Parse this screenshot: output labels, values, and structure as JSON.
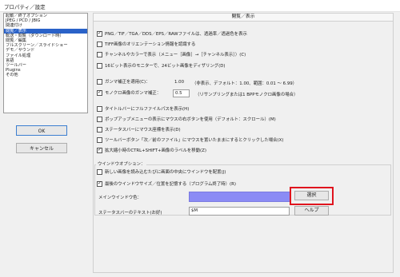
{
  "window": {
    "title": "プロパティ／設定"
  },
  "sidebar": {
    "items": [
      {
        "label": "起動／終了オプション"
      },
      {
        "label": "JPEG / PCD / JBIG"
      },
      {
        "label": "関連付け"
      },
      {
        "label": "閲覧／表示"
      },
      {
        "label": "転送・閲覧（ダウンロード時）"
      },
      {
        "label": "閲覧／編集"
      },
      {
        "label": "フルスクリーン／スライドショー"
      },
      {
        "label": "デモ／サウンド"
      },
      {
        "label": "ファイル処理"
      },
      {
        "label": "言語"
      },
      {
        "label": "ツールバー"
      },
      {
        "label": "Plugins"
      },
      {
        "label": "その他"
      }
    ],
    "selected_index": 3
  },
  "buttons": {
    "ok": "OK",
    "cancel": "キャンセル",
    "select": "選択",
    "help": "ヘルプ"
  },
  "panel": {
    "title": "閲覧／表示",
    "options": [
      {
        "label": "PNG／TIF／TGA／DDS／EPS／RAWファイルは、透過率／透過色を表示",
        "checked": true
      },
      {
        "label": "TIFF画像のオリエンテーション情報を認識する",
        "checked": false
      },
      {
        "label": "チャンネルやカラーで表示（メニュー［画像］→［チャンネル表示］）(C)",
        "checked": false
      },
      {
        "label": "16ビット表示のモニターで、24ビット画像をディザリング(D)",
        "checked": false
      }
    ],
    "gamma": {
      "label": "ガンマ補正を適用(C)：",
      "value": "1.00",
      "note": "（非表示、デフォルト：1.00、範囲：0.01 ～ 6.99）"
    },
    "mono_gamma": {
      "label": "モノクロ画像のガンマ補正：",
      "value": "0.5",
      "note": "（リサンプリングまたは1 BPPモノクロ画像の場合）"
    },
    "options2": [
      {
        "label": "タイトルバーにフルファイルパスを表示(H)",
        "checked": false
      },
      {
        "label": "ポップアップメニューの表示にマウスの右ボタンを使用（デフォルト：スクロール）(M)",
        "checked": false
      },
      {
        "label": "ステータスバーにマウス座標を表示(D)",
        "checked": false
      },
      {
        "label": "ツールバーボタン「次／前のファイル」にマウスを置いたままにするとクリックした場合(X)",
        "checked": false
      },
      {
        "label": "拡大縮小時のCTRL+SHIFT+画像のラベルを移動(Z)",
        "checked": true
      }
    ],
    "window_options": {
      "label": "ウインドウオプション：",
      "items": [
        {
          "label": "新しい画像を読み込むたびに画面の中央にウインドウを配置(J)",
          "checked": false
        },
        {
          "label": "最後のウインドウサイズ／位置を記憶する（プログラム終了時）(R)",
          "checked": true
        }
      ],
      "main_color_label": "メインウインドウ色：",
      "statusbar_font_label": "ステータスバーのテキスト(お好)",
      "statusbar_font_value": "$M"
    }
  },
  "colors": {
    "main_window_color": "#8b8bf5",
    "highlight": "#e0141e",
    "selection": "#2a62c8"
  }
}
